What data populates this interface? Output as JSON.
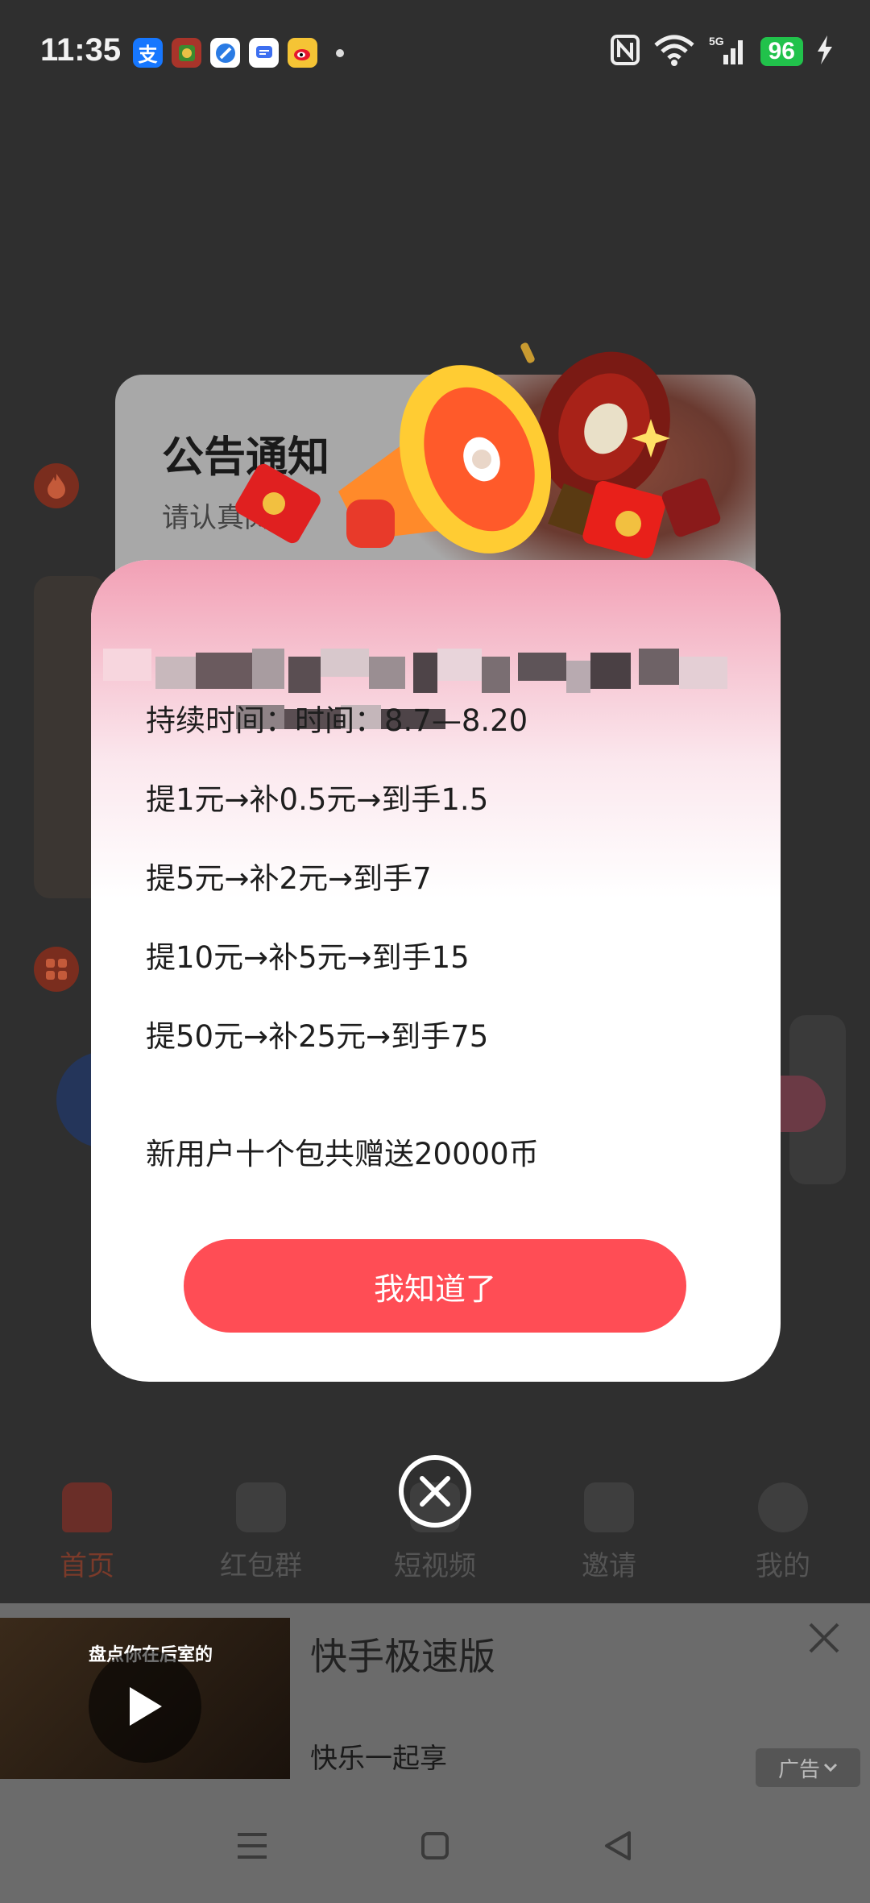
{
  "status_bar": {
    "time": "11:35",
    "notification_icons": [
      "alipay-icon",
      "game-icon",
      "browser-icon",
      "messages-icon",
      "weibo-icon"
    ],
    "alipay_glyph": "支",
    "battery": "96",
    "network": "5G"
  },
  "notice": {
    "title": "公告通知",
    "subtitle": "请认真阅读",
    "lines": [
      "持续时间：时间：8.7—8.20",
      "提1元→补0.5元→到手1.5",
      "提5元→补2元→到手7",
      "提10元→补5元→到手15",
      "提50元→补25元→到手75"
    ],
    "bonus": "新用户十个包共赠送20000币",
    "confirm_label": "我知道了"
  },
  "tabs": [
    {
      "label": "首页",
      "active": true
    },
    {
      "label": "红包群",
      "active": false
    },
    {
      "label": "短视频",
      "active": false
    },
    {
      "label": "邀请",
      "active": false
    },
    {
      "label": "我的",
      "active": false
    }
  ],
  "ad": {
    "thumb_text": "盘点你在后室的",
    "title": "快手极速版",
    "subtitle": "快乐一起享",
    "tag": "广告"
  },
  "colors": {
    "accent": "#ff4d55",
    "battery": "#21c24b"
  }
}
